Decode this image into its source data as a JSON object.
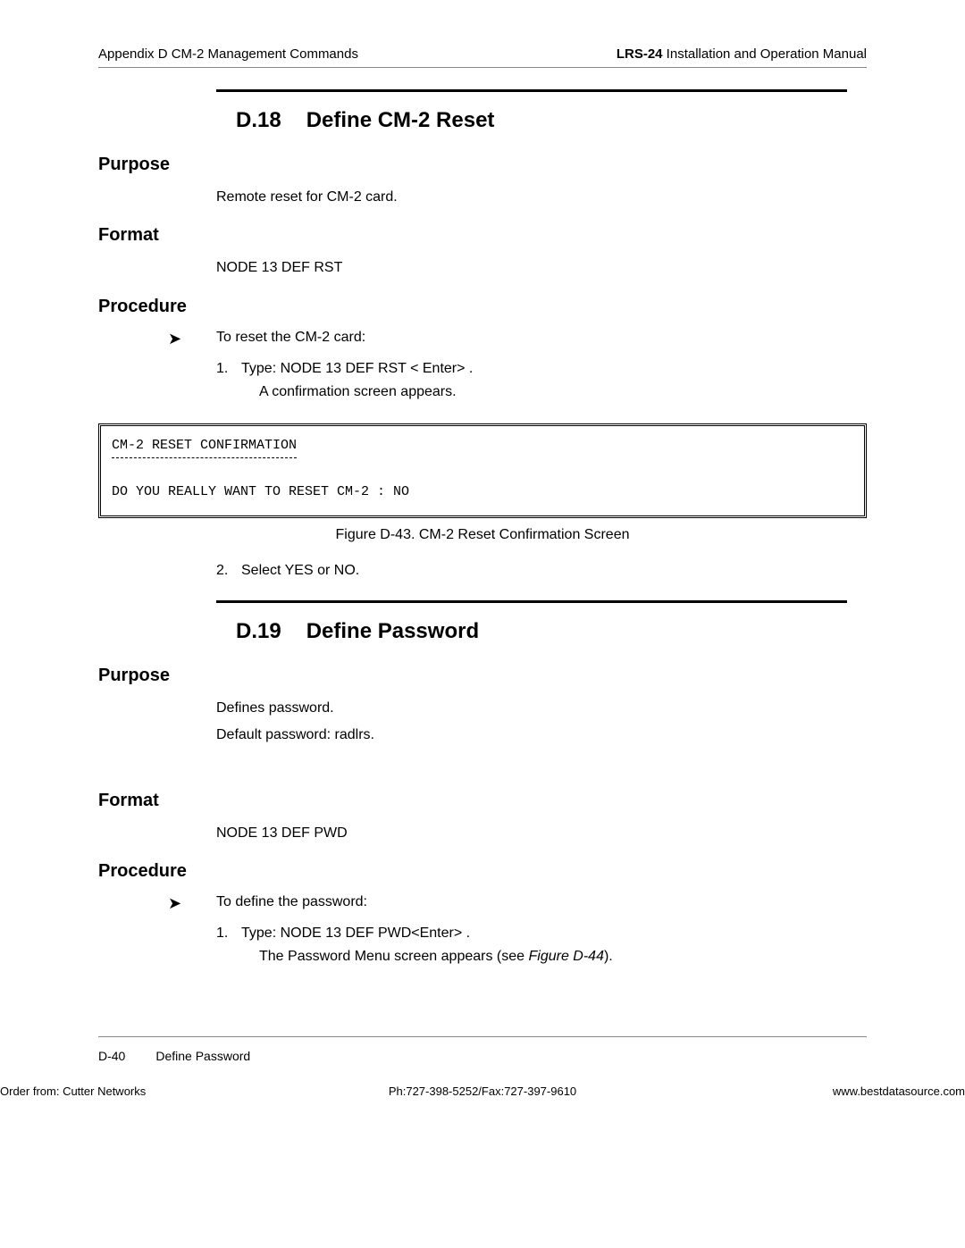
{
  "header": {
    "left": "Appendix D  CM-2 Management Commands",
    "right_bold": "LRS-24",
    "right_rest": " Installation and Operation Manual"
  },
  "section1": {
    "num": "D.18",
    "title": "Define CM-2 Reset",
    "purpose_heading": "Purpose",
    "purpose_text": "Remote reset for CM-2 card.",
    "format_heading": "Format",
    "format_text": "NODE 13 DEF RST",
    "procedure_heading": "Procedure",
    "proc_intro": "To reset the CM-2 card:",
    "step1_num": "1.",
    "step1_text": "Type: NODE 13 DEF RST < Enter> .",
    "step1_result": "A confirmation screen appears.",
    "terminal_line1": "CM-2 RESET CONFIRMATION",
    "terminal_line2": "DO YOU REALLY WANT TO RESET CM-2 : NO",
    "figure_caption": "Figure D-43.  CM-2 Reset Confirmation Screen",
    "step2_num": "2.",
    "step2_text": "Select YES or NO."
  },
  "section2": {
    "num": "D.19",
    "title": "Define Password",
    "purpose_heading": "Purpose",
    "purpose_text1": "Defines password.",
    "purpose_text2a": "Default password: ",
    "purpose_text2b": "radlrs",
    "purpose_text2c": ".",
    "format_heading": "Format",
    "format_text": "NODE 13 DEF PWD",
    "procedure_heading": "Procedure",
    "proc_intro": "To define the password:",
    "step1_num": "1.",
    "step1_text": "Type: NODE 13 DEF PWD<Enter> .",
    "step1_result_a": "The Password Menu screen appears (see ",
    "step1_result_b": "Figure D-44",
    "step1_result_c": ")."
  },
  "footer": {
    "page_num": "D-40",
    "page_title": "Define Password",
    "bottom_left": "Order from: Cutter Networks",
    "bottom_center": "Ph:727-398-5252/Fax:727-397-9610",
    "bottom_right": "www.bestdatasource.com"
  }
}
